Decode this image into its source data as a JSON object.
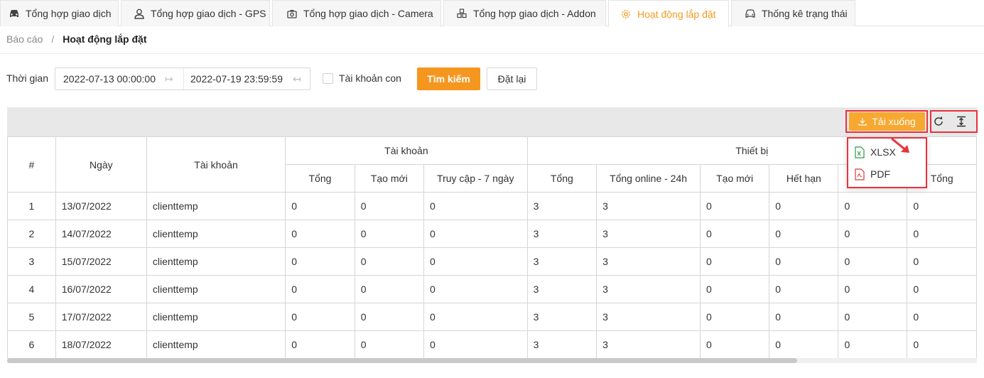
{
  "tabs": [
    {
      "label": "Tổng hợp giao dịch",
      "icon": "car-icon",
      "active": false
    },
    {
      "label": "Tổng hợp giao dịch - GPS",
      "icon": "user-icon",
      "active": false
    },
    {
      "label": "Tổng hợp giao dịch - Camera",
      "icon": "camera-icon",
      "active": false
    },
    {
      "label": "Tổng hợp giao dịch - Addon",
      "icon": "cubes-icon",
      "active": false
    },
    {
      "label": "Hoạt động lắp đặt",
      "icon": "gear-icon",
      "active": true
    },
    {
      "label": "Thống kê trạng thái",
      "icon": "car-icon",
      "active": false
    }
  ],
  "breadcrumb": {
    "parent": "Báo cáo",
    "separator": "/",
    "current": "Hoạt động lắp đặt"
  },
  "filter": {
    "label": "Thời gian",
    "start": "2022-07-13 00:00:00",
    "end": "2022-07-19 23:59:59",
    "sub_account_label": "Tài khoản con",
    "search_label": "Tìm kiếm",
    "reset_label": "Đặt lại"
  },
  "toolbar": {
    "download_label": "Tải xuống"
  },
  "dropdown": {
    "xlsx": "XLSX",
    "pdf": "PDF"
  },
  "colors": {
    "accent": "#f5961f",
    "highlight": "#e8323c"
  },
  "table": {
    "headers": {
      "index": "#",
      "date": "Ngày",
      "account": "Tài khoản",
      "group_account": "Tài khoản",
      "group_device": "Thiết bị",
      "acc_total": "Tổng",
      "acc_new": "Tạo mới",
      "acc_access": "Truy cập - 7 ngày",
      "dev_total": "Tổng",
      "dev_online": "Tổng online - 24h",
      "dev_new": "Tạo mới",
      "dev_expired": "Hết hạn",
      "extra_total": "Tổng"
    },
    "rows": [
      [
        "1",
        "13/07/2022",
        "clienttemp",
        "0",
        "0",
        "0",
        "3",
        "3",
        "0",
        "0",
        "0",
        "0"
      ],
      [
        "2",
        "14/07/2022",
        "clienttemp",
        "0",
        "0",
        "0",
        "3",
        "3",
        "0",
        "0",
        "0",
        "0"
      ],
      [
        "3",
        "15/07/2022",
        "clienttemp",
        "0",
        "0",
        "0",
        "3",
        "3",
        "0",
        "0",
        "0",
        "0"
      ],
      [
        "4",
        "16/07/2022",
        "clienttemp",
        "0",
        "0",
        "0",
        "3",
        "3",
        "0",
        "0",
        "0",
        "0"
      ],
      [
        "5",
        "17/07/2022",
        "clienttemp",
        "0",
        "0",
        "0",
        "3",
        "3",
        "0",
        "0",
        "0",
        "0"
      ],
      [
        "6",
        "18/07/2022",
        "clienttemp",
        "0",
        "0",
        "0",
        "3",
        "3",
        "0",
        "0",
        "0",
        "0"
      ]
    ]
  }
}
